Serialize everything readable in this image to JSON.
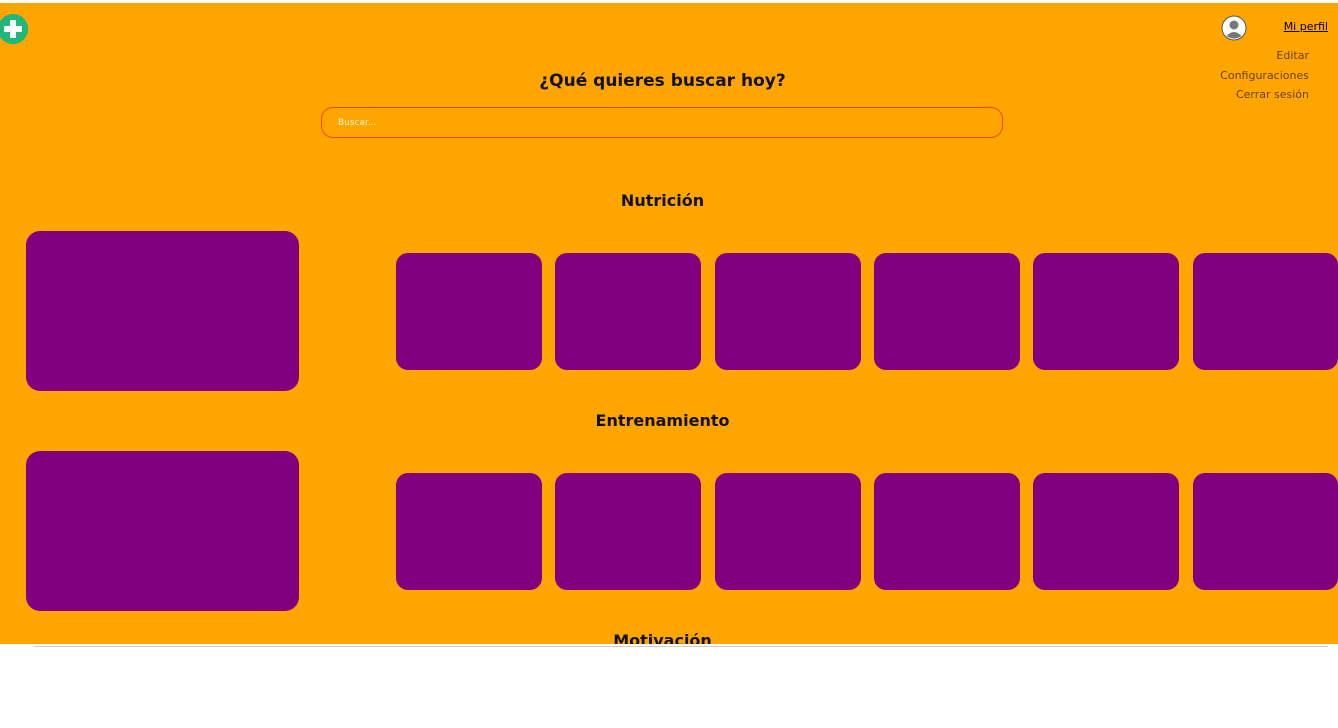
{
  "header": {
    "add_icon": "plus-circle-icon",
    "profile": {
      "avatar_icon": "user-avatar-icon",
      "link_label": "Mi perfil",
      "menu": [
        "Editar",
        "Configuraciones",
        "Cerrar sesión"
      ]
    }
  },
  "search": {
    "title": "¿Qué quieres buscar hoy?",
    "placeholder": "Buscar...",
    "value": ""
  },
  "sections": [
    {
      "title": "Nutrición"
    },
    {
      "title": "Entrenamiento"
    },
    {
      "title": "Motivación"
    }
  ],
  "colors": {
    "background": "#ffa500",
    "card": "#800080",
    "add_button": "#1fb87a",
    "search_border": "#e64a19"
  }
}
